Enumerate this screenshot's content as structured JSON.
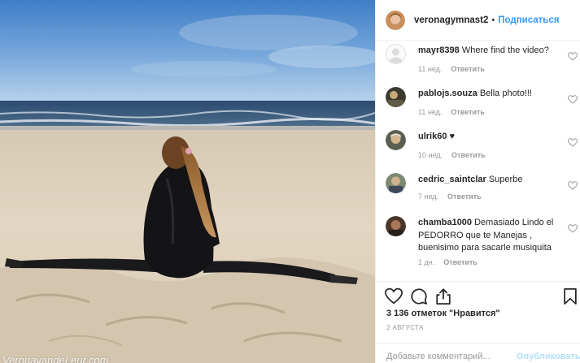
{
  "post": {
    "username": "veronagymnast2",
    "separator": "•",
    "follow_label": "Подписаться",
    "watermark_text": "VeronavandeLeur.com"
  },
  "comments": [
    {
      "user": "mayr8398",
      "text": "Where find the video?",
      "time": "11 нед.",
      "reply": "Ответить",
      "avatar": "default-avatar"
    },
    {
      "user": "pablojs.souza",
      "text": "Bella photo!!!",
      "time": "11 нед.",
      "reply": "Ответить",
      "avatar": "user-avatar"
    },
    {
      "user": "ulrik60",
      "text": "♥",
      "time": "10 нед.",
      "reply": "Ответить",
      "avatar": "user-avatar"
    },
    {
      "user": "cedric_saintclar",
      "text": "Superbe",
      "time": "7 нед.",
      "reply": "Ответить",
      "avatar": "user-avatar"
    },
    {
      "user": "chamba1000",
      "text": "Demasiado Lindo el PEDORRO que te Manejas , buenisimo para sacarle musiquita",
      "time": "1 дн.",
      "reply": "Ответить",
      "avatar": "user-avatar"
    }
  ],
  "actions": {
    "icons": [
      "heart-icon",
      "comment-icon",
      "share-icon",
      "bookmark-icon"
    ]
  },
  "likes": {
    "count": "3 136",
    "text": "отметок \"Нравится\""
  },
  "date": "2 АВГУСТА",
  "add_comment": {
    "placeholder": "Добавьте комментарий...",
    "publish_label": "Опубликовать"
  },
  "colors": {
    "link_blue": "#3897f0",
    "publish_disabled": "#b2dffc",
    "secondary_text": "#999999",
    "primary_text": "#262626",
    "border": "#efefef"
  }
}
